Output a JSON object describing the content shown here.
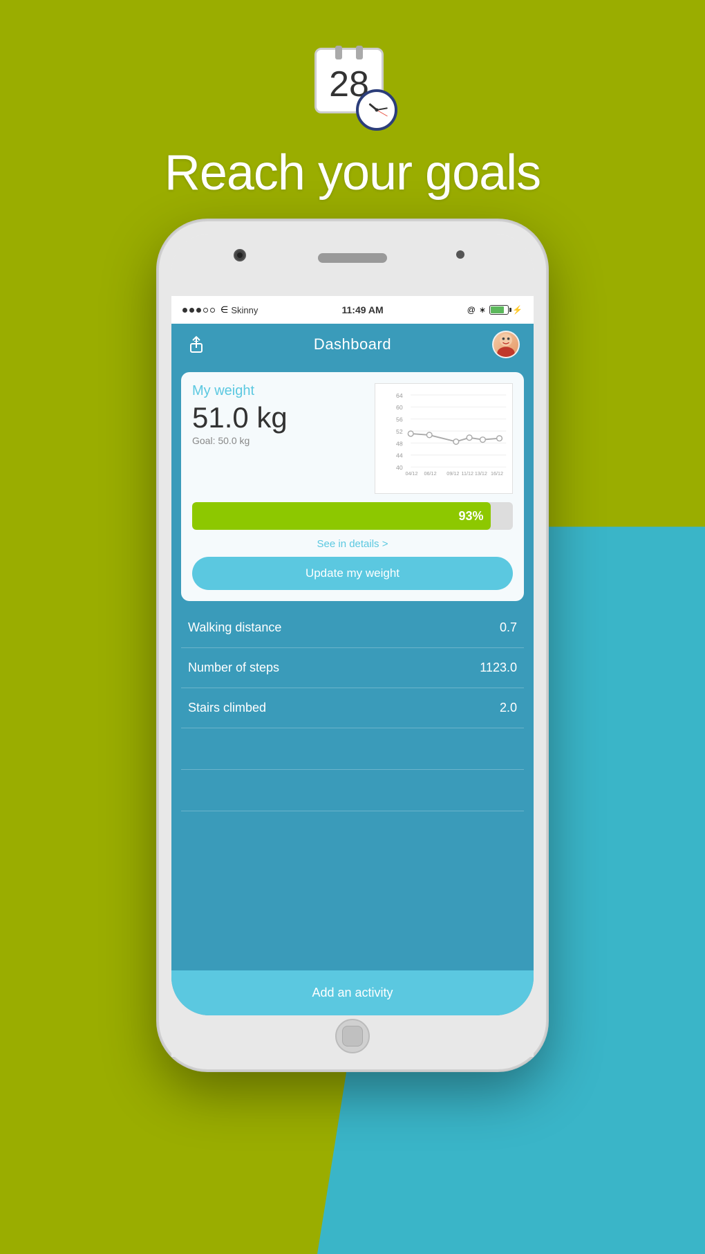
{
  "background": {
    "top_color": "#9aad00",
    "bottom_blue_color": "#3ab5c8"
  },
  "header": {
    "calendar_number": "28",
    "main_title": "Reach your goals"
  },
  "phone": {
    "status_bar": {
      "carrier": "Skinny",
      "wifi": true,
      "time": "11:49 AM",
      "battery_percent": 80
    },
    "nav": {
      "title": "Dashboard",
      "share_icon": "share-icon",
      "avatar_icon": "avatar-icon"
    },
    "weight_card": {
      "label": "My weight",
      "value": "51.0 kg",
      "goal": "Goal: 50.0 kg",
      "progress_percent": 93,
      "progress_label": "93%",
      "see_details_label": "See in details >",
      "update_button_label": "Update my weight",
      "chart": {
        "y_labels": [
          "64",
          "60",
          "56",
          "52",
          "48",
          "44",
          "40"
        ],
        "x_labels": [
          "04/12",
          "06/12",
          "09/12",
          "11/12",
          "13/12",
          "16/12"
        ],
        "data_points": [
          51,
          50.5,
          48.5,
          49,
          49.5,
          49.2
        ]
      }
    },
    "stats": [
      {
        "label": "Walking distance",
        "value": "0.7"
      },
      {
        "label": "Number of steps",
        "value": "1123.0"
      },
      {
        "label": "Stairs climbed",
        "value": "2.0"
      },
      {
        "label": "",
        "value": ""
      },
      {
        "label": "",
        "value": ""
      }
    ],
    "add_activity_button": "Add an activity"
  }
}
